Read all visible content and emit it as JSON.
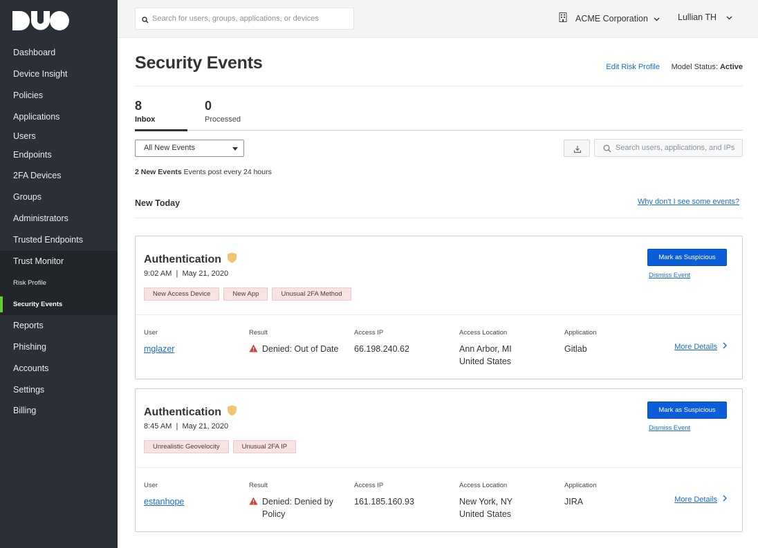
{
  "brand": {
    "logo_text": "DUO",
    "accent": "#66cc33",
    "link_color": "#1a6bd6",
    "primary_button": "#0b5ed7"
  },
  "sidebar": {
    "items_top": [
      {
        "label": "Dashboard"
      },
      {
        "label": "Device Insight"
      },
      {
        "label": "Policies"
      },
      {
        "label": "Applications"
      },
      {
        "label": "Users"
      },
      {
        "label": "Endpoints"
      },
      {
        "label": "2FA Devices"
      },
      {
        "label": "Groups"
      },
      {
        "label": "Administrators"
      },
      {
        "label": "Trusted Endpoints"
      }
    ],
    "trust_monitor": {
      "label": "Trust Monitor",
      "subitems": [
        {
          "label": "Risk Profile"
        },
        {
          "label": "Security Events",
          "active": true
        }
      ]
    },
    "items_bottom": [
      {
        "label": "Reports"
      },
      {
        "label": "Phishing"
      },
      {
        "label": "Accounts"
      },
      {
        "label": "Settings"
      },
      {
        "label": "Billing"
      }
    ]
  },
  "topbar": {
    "search_placeholder": "Search for users, groups, applications, or devices",
    "org_name": "ACME Corporation",
    "user_name": "Lullian TH"
  },
  "page": {
    "title": "Security Events",
    "edit_risk_profile": "Edit Risk Profile",
    "model_status_label": "Model Status:",
    "model_status_value": "Active"
  },
  "tabs": [
    {
      "count": "8",
      "label": "Inbox",
      "active": true
    },
    {
      "count": "0",
      "label": "Processed",
      "active": false
    }
  ],
  "filters": {
    "selected": "All New Events",
    "search_placeholder": "Search users, applications, and IPs"
  },
  "summary": {
    "count_text": "2 New Events",
    "note": "Events post every 24 hours"
  },
  "section": {
    "title": "New Today",
    "why_link": "Why don't I see some events?"
  },
  "columns": {
    "user": "User",
    "result": "Result",
    "access_ip": "Access IP",
    "access_location": "Access Location",
    "application": "Application"
  },
  "actions": {
    "mark_suspicious": "Mark as Suspicious",
    "dismiss": "Dismiss Event",
    "more_details": "More Details"
  },
  "events": [
    {
      "type": "Authentication",
      "time": "9:02 AM  |  May 21, 2020",
      "tags": [
        "New Access Device",
        "New App",
        "Unusual 2FA Method"
      ],
      "user": "mglazer",
      "result": "Denied: Out of Date",
      "access_ip": "66.198.240.62",
      "location_line1": "Ann Arbor, MI",
      "location_line2": "United States",
      "application": "Gitlab"
    },
    {
      "type": "Authentication",
      "time": "8:45 AM  |  May 21, 2020",
      "tags": [
        "Unrealistic Geovelocity",
        "Unusual 2FA IP"
      ],
      "user": "estanhope",
      "result": "Denied: Denied by Policy",
      "access_ip": "161.185.160.93",
      "location_line1": "New York, NY",
      "location_line2": "United States",
      "application": "JIRA"
    }
  ]
}
